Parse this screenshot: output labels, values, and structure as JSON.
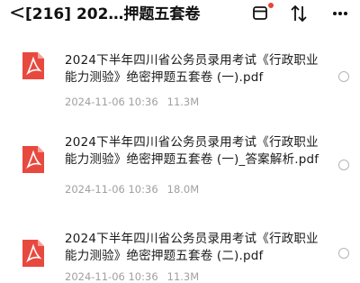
{
  "header": {
    "title": "[216] 202…押题五套卷",
    "back_icon": "chevron-left-icon",
    "icons": [
      "window-icon",
      "sort-icon",
      "more-icon"
    ],
    "notification_color": "#e8443a"
  },
  "files": [
    {
      "name": "2024下半年四川省公务员录用考试《行政职业能力测验》绝密押题五套卷 (一).pdf",
      "date": "2024-11-06 10:36",
      "size": "11.3M"
    },
    {
      "name": "2024下半年四川省公务员录用考试《行政职业能力测验》绝密押题五套卷 (一)_答案解析.pdf",
      "date": "2024-11-06 10:36",
      "size": "18.0M"
    },
    {
      "name": "2024下半年四川省公务员录用考试《行政职业能力测验》绝密押题五套卷 (二).pdf",
      "date": "2024-11-06 10:36",
      "size": "11.3M"
    }
  ],
  "colors": {
    "pdf_icon": "#e8493f",
    "meta_text": "#a0a0a0"
  }
}
